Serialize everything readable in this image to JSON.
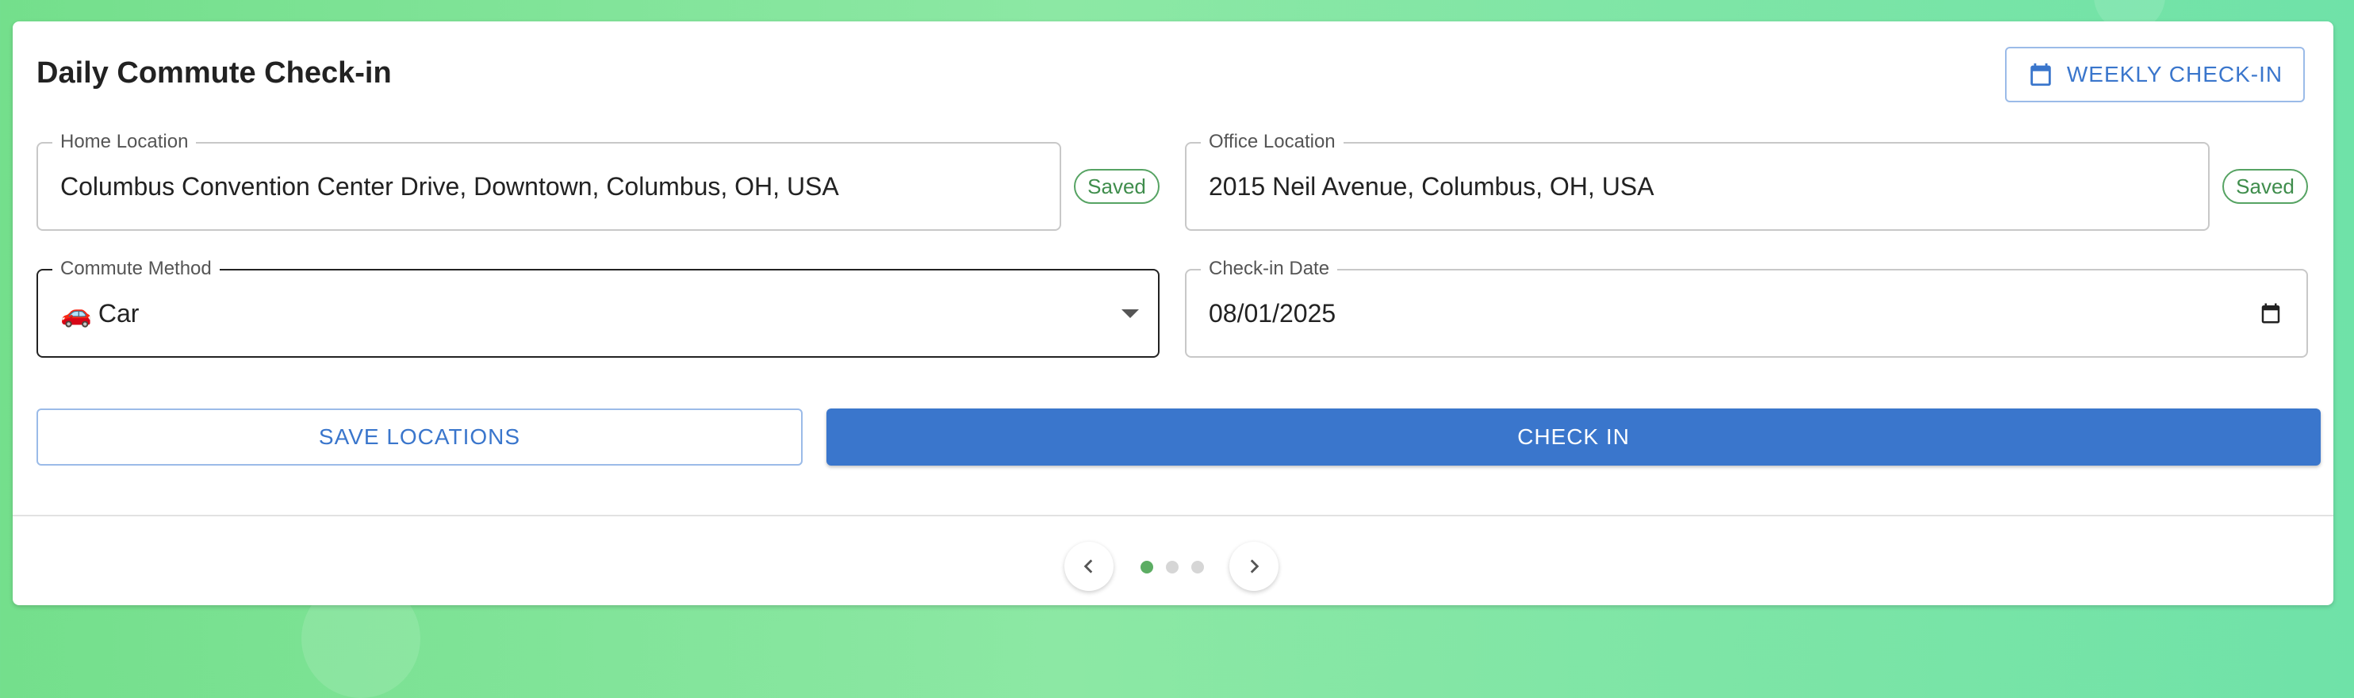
{
  "app": {
    "title": "Daily Commute Check-in"
  },
  "header": {
    "weekly_button_label": "WEEKLY CHECK-IN",
    "weekly_button_icon": "calendar-icon"
  },
  "form": {
    "home": {
      "label": "Home Location",
      "value": "Columbus Convention Center Drive, Downtown, Columbus, OH, USA",
      "status": "Saved"
    },
    "office": {
      "label": "Office Location",
      "value": "2015 Neil Avenue, Columbus, OH, USA",
      "status": "Saved"
    },
    "commute_method": {
      "label": "Commute Method",
      "emoji": "🚗",
      "value": "Car"
    },
    "checkin_date": {
      "label": "Check-in Date",
      "value": "08/01/2025"
    }
  },
  "actions": {
    "save_label": "SAVE LOCATIONS",
    "checkin_label": "CHECK IN"
  },
  "pagination": {
    "total_pages": 3,
    "current_page": 1
  },
  "colors": {
    "primary": "#3a76cc",
    "saved_green": "#56a363",
    "active_dot": "#5cad63",
    "background_gradient_start": "#74df8c",
    "background_gradient_end": "#6fe2a8"
  }
}
